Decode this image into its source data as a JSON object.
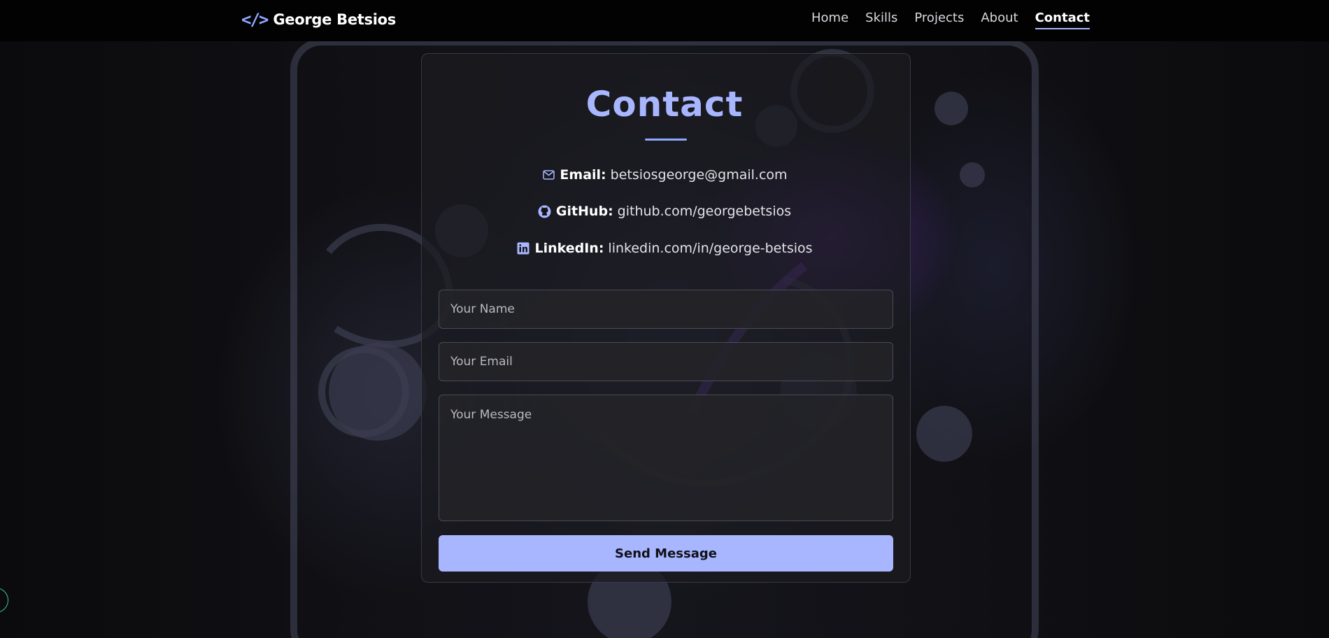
{
  "brand": {
    "icon": "code-brackets-icon",
    "icon_glyph": "</>",
    "name": "George Betsios"
  },
  "nav": {
    "items": [
      {
        "label": "Home",
        "active": false
      },
      {
        "label": "Skills",
        "active": false
      },
      {
        "label": "Projects",
        "active": false
      },
      {
        "label": "About",
        "active": false
      },
      {
        "label": "Contact",
        "active": true
      }
    ]
  },
  "contact": {
    "title": "Contact",
    "email": {
      "icon": "mail-icon",
      "label": "Email:",
      "value": "betsiosgeorge@gmail.com"
    },
    "github": {
      "icon": "github-icon",
      "label": "GitHub:",
      "value": "github.com/georgebetsios"
    },
    "linkedin": {
      "icon": "linkedin-icon",
      "label": "LinkedIn:",
      "value": "linkedin.com/in/george-betsios"
    }
  },
  "form": {
    "name_placeholder": "Your Name",
    "email_placeholder": "Your Email",
    "message_placeholder": "Your Message",
    "name_value": "",
    "email_value": "",
    "message_value": "",
    "submit_label": "Send Message"
  },
  "colors": {
    "accent": "#a8b6ff",
    "navbar_bg": "#020203",
    "page_bg": "#0a0a0c"
  }
}
